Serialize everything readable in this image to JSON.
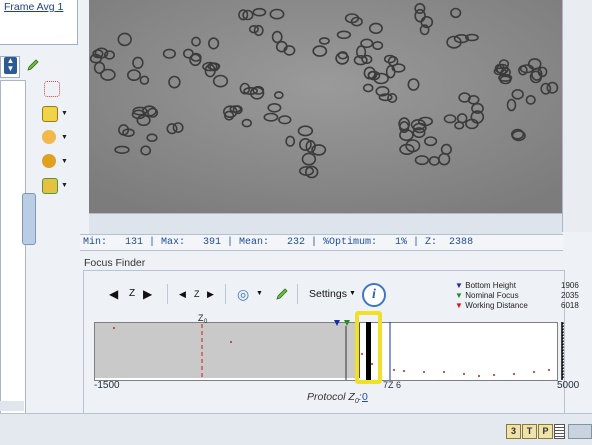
{
  "left_panel": {
    "frame_avg_link": "Frame Avg 1",
    "tool_icons": [
      "grid-icon",
      "add-layer-icon",
      "drop-icon",
      "gears-icon",
      "shapes-icon"
    ]
  },
  "stats": {
    "text": "Min:   131 | Max:   391 | Mean:   232 | %Optimum:   1% | Z:  2388"
  },
  "focus_finder": {
    "title": "Focus Finder",
    "toolbar": {
      "z_label_1": "Z",
      "z_label_2": "Z",
      "settings_label": "Settings",
      "info_label": "i"
    },
    "legend": [
      {
        "label": "Bottom Height",
        "value": "1906",
        "color": "#1b2fa0"
      },
      {
        "label": "Nominal Focus",
        "value": "2035",
        "color": "#2a8a2a"
      },
      {
        "label": "Working Distance",
        "value": "6018",
        "color": "#d01c1c"
      }
    ],
    "graph": {
      "axis_min": "-1500",
      "axis_max": "5000",
      "z0_label": "Z",
      "z0_sub": "0",
      "mid_label": "7Z 6"
    },
    "protocol_label": "Protocol Z",
    "protocol_sub": "0",
    "protocol_value": "0"
  },
  "colors": {
    "highlight": "#f1e02b",
    "link": "#1f3f8f",
    "stats_text": "#1d4f9a"
  }
}
